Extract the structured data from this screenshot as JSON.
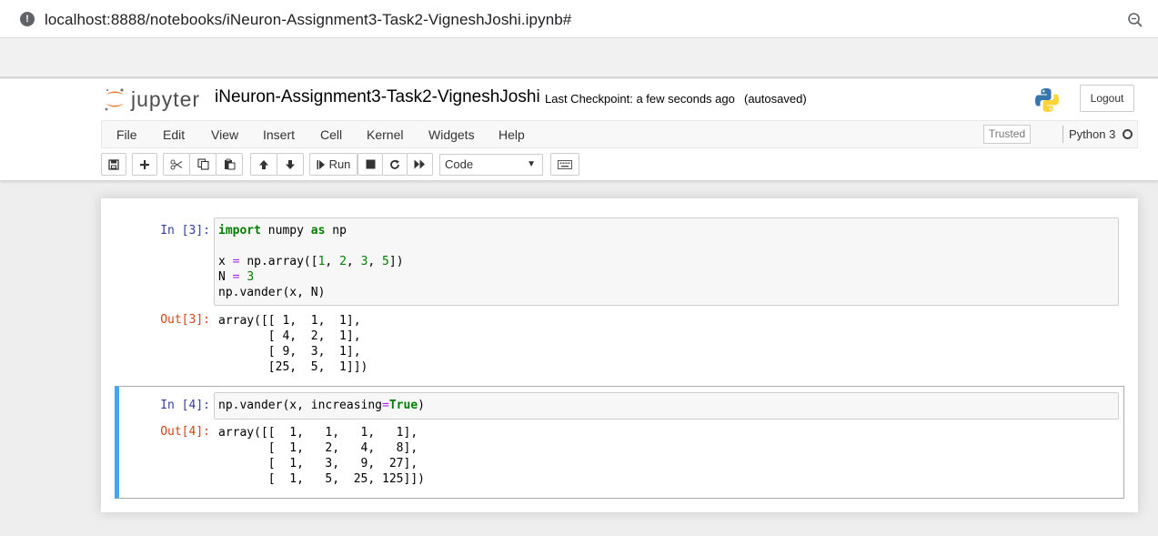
{
  "browser": {
    "url": "localhost:8888/notebooks/iNeuron-Assignment3-Task2-VigneshJoshi.ipynb#"
  },
  "header": {
    "logo_text": "jupyter",
    "notebook_name": "iNeuron-Assignment3-Task2-VigneshJoshi",
    "checkpoint": "Last Checkpoint: a few seconds ago",
    "autosave": "(autosaved)",
    "logout_label": "Logout"
  },
  "menu": {
    "items": [
      "File",
      "Edit",
      "View",
      "Insert",
      "Cell",
      "Kernel",
      "Widgets",
      "Help"
    ],
    "trusted": "Trusted",
    "kernel_name": "Python 3"
  },
  "toolbar": {
    "run_label": "Run",
    "cell_type": "Code",
    "icons": [
      "save-icon",
      "plus-icon",
      "cut-icon",
      "copy-icon",
      "paste-icon",
      "arrow-up-icon",
      "arrow-down-icon",
      "run-icon",
      "stop-icon",
      "restart-icon",
      "fast-forward-icon",
      "keyboard-icon"
    ]
  },
  "cells": [
    {
      "in_prompt": "In [3]:",
      "out_prompt": "Out[3]:",
      "output": "array([[ 1,  1,  1],\n       [ 4,  2,  1],\n       [ 9,  3,  1],\n       [25,  5,  1]])"
    },
    {
      "in_prompt": "In [4]:",
      "out_prompt": "Out[4]:",
      "output": "array([[  1,   1,   1,   1],\n       [  1,   2,   4,   8],\n       [  1,   3,   9,  27],\n       [  1,   5,  25, 125]])"
    }
  ],
  "colors": {
    "in_prompt": "#303f9f",
    "out_prompt": "#d84315",
    "selected_cell_border": "#42a5f5",
    "keyword": "#008000",
    "operator": "#aa22ff"
  }
}
